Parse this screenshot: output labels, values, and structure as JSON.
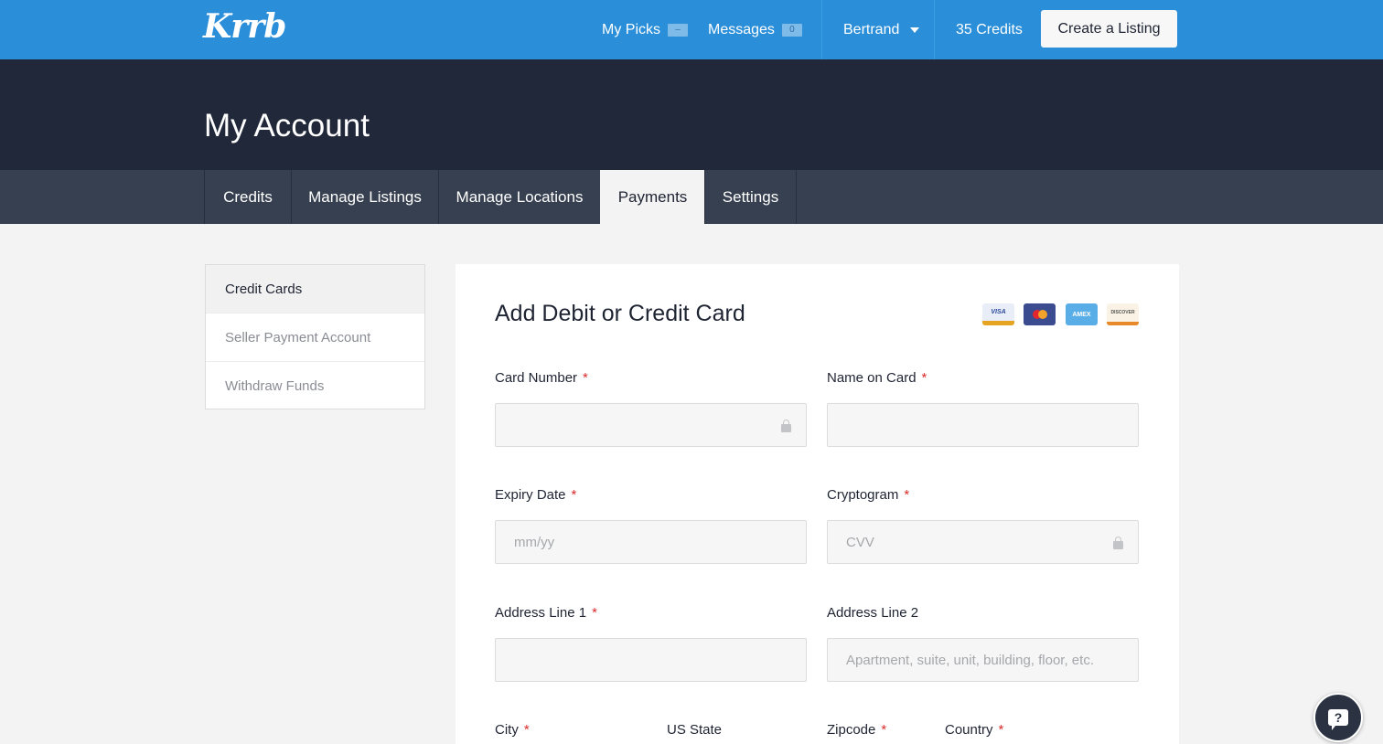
{
  "topbar": {
    "logo": "Krrb",
    "my_picks": {
      "label": "My Picks",
      "badge": "–"
    },
    "messages": {
      "label": "Messages",
      "badge": "0"
    },
    "user": "Bertrand",
    "credits": "35 Credits",
    "create_listing": "Create a Listing"
  },
  "header": {
    "title": "My Account"
  },
  "tabs": [
    {
      "label": "Credits"
    },
    {
      "label": "Manage Listings"
    },
    {
      "label": "Manage Locations"
    },
    {
      "label": "Payments",
      "active": true
    },
    {
      "label": "Settings"
    }
  ],
  "sidebar": {
    "items": [
      {
        "label": "Credit Cards",
        "active": true
      },
      {
        "label": "Seller Payment Account"
      },
      {
        "label": "Withdraw Funds"
      }
    ]
  },
  "form": {
    "title": "Add Debit or Credit Card",
    "card_brands": {
      "visa": "VISA",
      "mastercard": "",
      "amex": "AMEX",
      "discover": "DISCOVER"
    },
    "required_mark": "*",
    "card_number": {
      "label": "Card Number",
      "value": "",
      "placeholder": ""
    },
    "name_on_card": {
      "label": "Name on Card",
      "value": "",
      "placeholder": ""
    },
    "expiry_date": {
      "label": "Expiry Date",
      "placeholder": "mm/yy"
    },
    "cryptogram": {
      "label": "Cryptogram",
      "placeholder": "CVV"
    },
    "address_line_1": {
      "label": "Address Line 1",
      "placeholder": ""
    },
    "address_line_2": {
      "label": "Address Line 2",
      "placeholder": "Apartment, suite, unit, building, floor, etc."
    },
    "city": {
      "label": "City"
    },
    "us_state": {
      "label": "US State"
    },
    "zipcode": {
      "label": "Zipcode"
    },
    "country": {
      "label": "Country"
    }
  },
  "help": {
    "icon_text": "?"
  },
  "colors": {
    "topbar": "#2a8ed8",
    "hero": "#20283a",
    "tabbar": "#374050",
    "required": "#d92c2c"
  }
}
